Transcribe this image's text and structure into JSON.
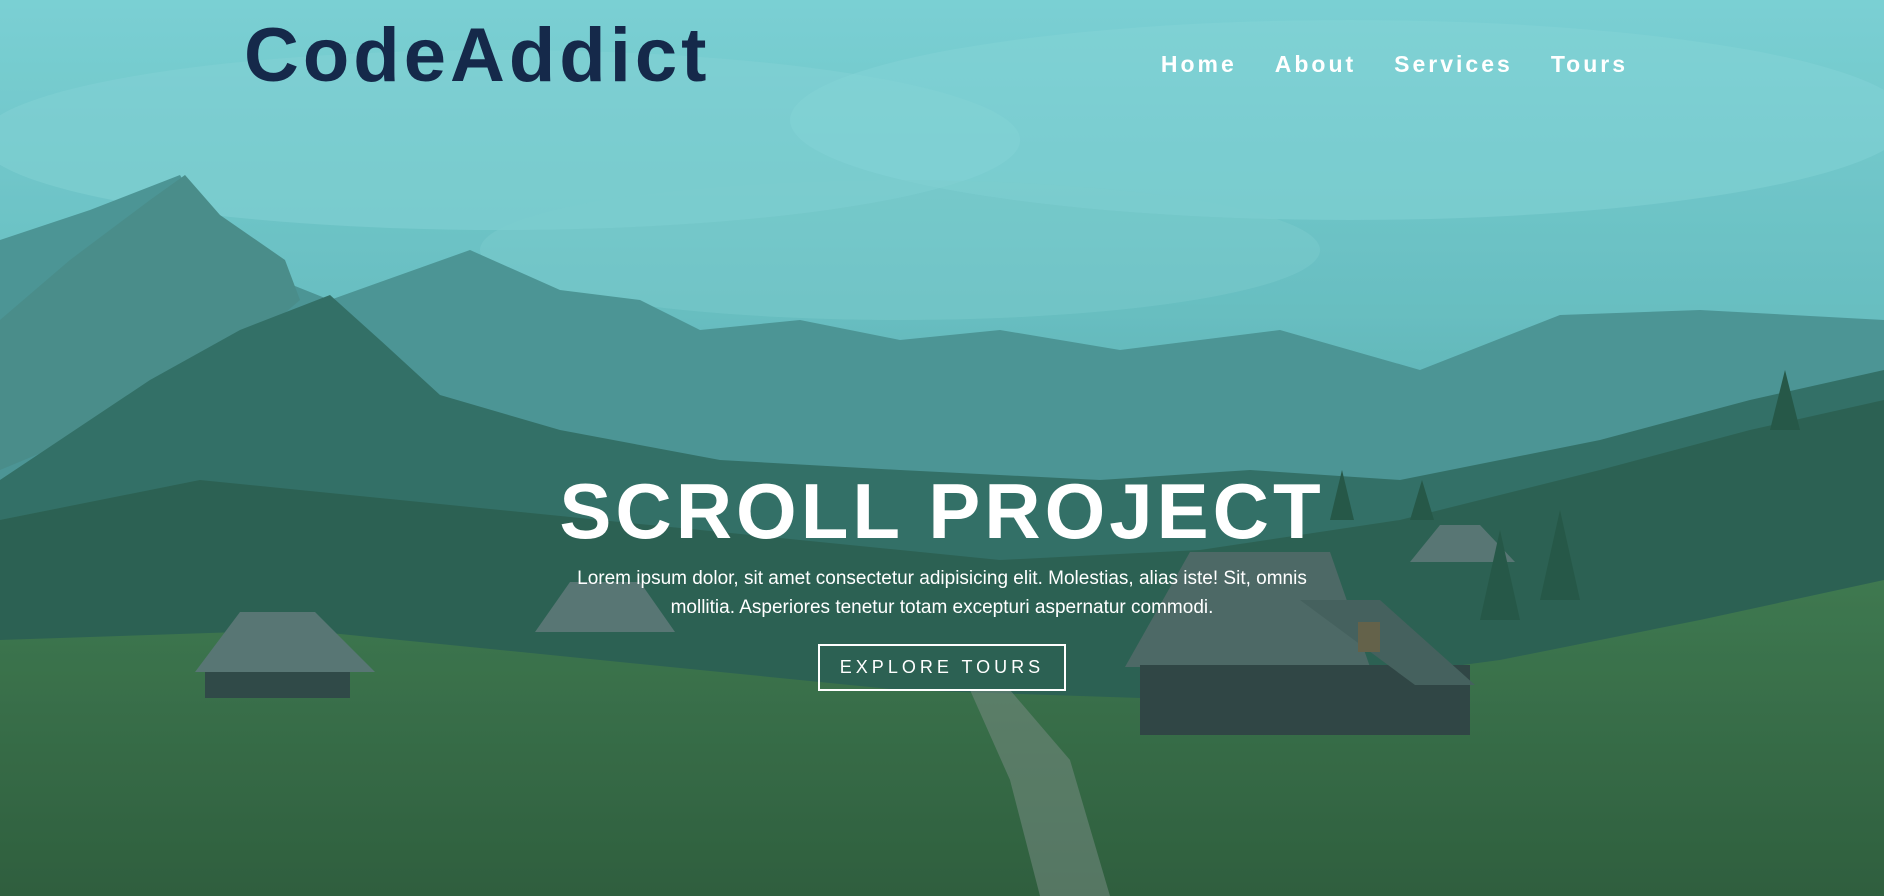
{
  "nav": {
    "logo": "CodeAddict",
    "links": [
      "Home",
      "About",
      "Services",
      "Tours"
    ]
  },
  "banner": {
    "title": "SCROLL PROJECT",
    "text": "Lorem ipsum dolor, sit amet consectetur adipisicing elit. Molestias, alias iste! Sit, omnis mollitia. Asperiores tenetur totam excepturi aspernatur commodi.",
    "button_label": "EXPLORE TOURS"
  },
  "colors": {
    "logo": "#15294a",
    "nav_text": "#ffffff",
    "banner_text": "#ffffff",
    "sky": "#7ccfd2",
    "mountain": "#3f7d79",
    "forest": "#2d5a3c",
    "meadow": "#3c6b2f"
  }
}
